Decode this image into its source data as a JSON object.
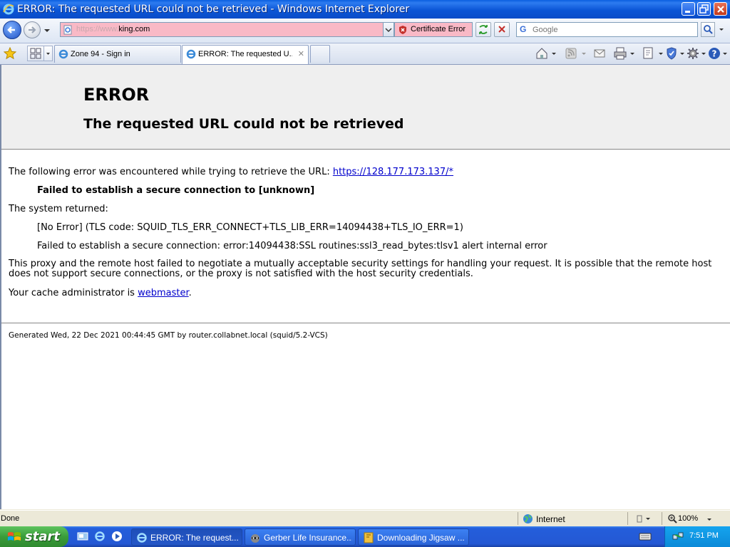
{
  "window": {
    "title": "ERROR: The requested URL could not be retrieved - Windows Internet Explorer"
  },
  "navbar": {
    "address_scheme": "https://www.",
    "address_host": "king.com",
    "cert_error_label": "Certificate Error",
    "search_placeholder": "Google"
  },
  "tabs": [
    {
      "label": "Zone 94 - Sign in"
    },
    {
      "label": "ERROR: The requested U..."
    }
  ],
  "page": {
    "heading": "ERROR",
    "subheading": "The requested URL could not be retrieved",
    "intro_text": "The following error was encountered while trying to retrieve the URL:",
    "url_link": "https://128.177.173.137/*",
    "error_bold": "Failed to establish a secure connection to [unknown]",
    "system_returned": "The system returned:",
    "tls_code": "[No Error] (TLS code: SQUID_TLS_ERR_CONNECT+TLS_LIB_ERR=14094438+TLS_IO_ERR=1)",
    "ssl_error": "Failed to establish a secure connection: error:14094438:SSL routines:ssl3_read_bytes:tlsv1 alert internal error",
    "explanation": "This proxy and the remote host failed to negotiate a mutually acceptable security settings for handling your request. It is possible that the remote host does not support secure connections, or the proxy is not satisfied with the host security credentials.",
    "admin_prefix": "Your cache administrator is",
    "admin_link": "webmaster",
    "admin_suffix": ".",
    "footer": "Generated Wed, 22 Dec 2021 00:44:45 GMT by router.collabnet.local (squid/5.2-VCS)"
  },
  "statusbar": {
    "status": "Done",
    "zone": "Internet",
    "zoom": "100%"
  },
  "taskbar": {
    "start_label": "start",
    "tasks": [
      {
        "label": "ERROR: The request..."
      },
      {
        "label": "Gerber Life Insurance..."
      },
      {
        "label": "Downloading Jigsaw ..."
      }
    ],
    "clock": "7:51 PM"
  },
  "colors": {
    "titlebar": "#0a55d6",
    "address_error_bg": "#f9b9c6",
    "link": "#0000cc",
    "taskbar": "#245edb",
    "start_button": "#3a9c3a"
  }
}
